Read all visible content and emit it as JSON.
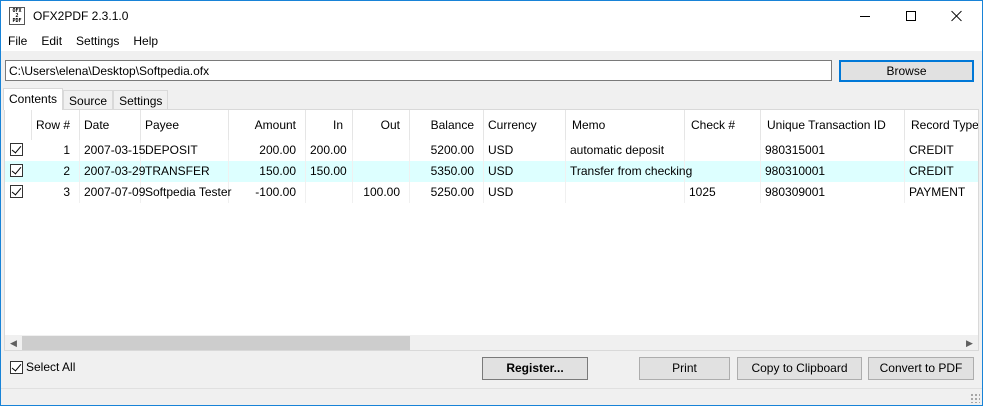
{
  "window": {
    "title": "OFX2PDF 2.3.1.0",
    "icon_text": "OFX\n2\nPDF"
  },
  "menu": [
    "File",
    "Edit",
    "Settings",
    "Help"
  ],
  "file": {
    "path": "C:\\Users\\elena\\Desktop\\Softpedia.ofx",
    "browse_label": "Browse"
  },
  "tabs": [
    {
      "label": "Contents",
      "active": true
    },
    {
      "label": "Source",
      "active": false
    },
    {
      "label": "Settings",
      "active": false
    }
  ],
  "table": {
    "columns": [
      "Row #",
      "Date",
      "Payee",
      "Amount",
      "In",
      "Out",
      "Balance",
      "Currency",
      "Memo",
      "Check #",
      "Unique Transaction ID",
      "Record Type"
    ],
    "rows": [
      {
        "checked": true,
        "selected": false,
        "cells": [
          "1",
          "2007-03-15",
          "DEPOSIT",
          "200.00",
          "200.00",
          "",
          "5200.00",
          "USD",
          "automatic deposit",
          "",
          "980315001",
          "CREDIT"
        ]
      },
      {
        "checked": true,
        "selected": true,
        "cells": [
          "2",
          "2007-03-29",
          "TRANSFER",
          "150.00",
          "150.00",
          "",
          "5350.00",
          "USD",
          "Transfer from checking",
          "",
          "980310001",
          "CREDIT"
        ]
      },
      {
        "checked": true,
        "selected": false,
        "cells": [
          "3",
          "2007-07-09",
          "Softpedia Tester",
          "-100.00",
          "",
          "100.00",
          "5250.00",
          "USD",
          "",
          "1025",
          "980309001",
          "PAYMENT"
        ]
      }
    ],
    "highlight_color": "#ddffff"
  },
  "bottom": {
    "select_all_label": "Select All",
    "select_all_checked": true,
    "register_label": "Register...",
    "print_label": "Print",
    "copy_label": "Copy to Clipboard",
    "convert_label": "Convert to PDF"
  },
  "colors": {
    "accent": "#0078d7",
    "window_border": "#1883d7"
  }
}
